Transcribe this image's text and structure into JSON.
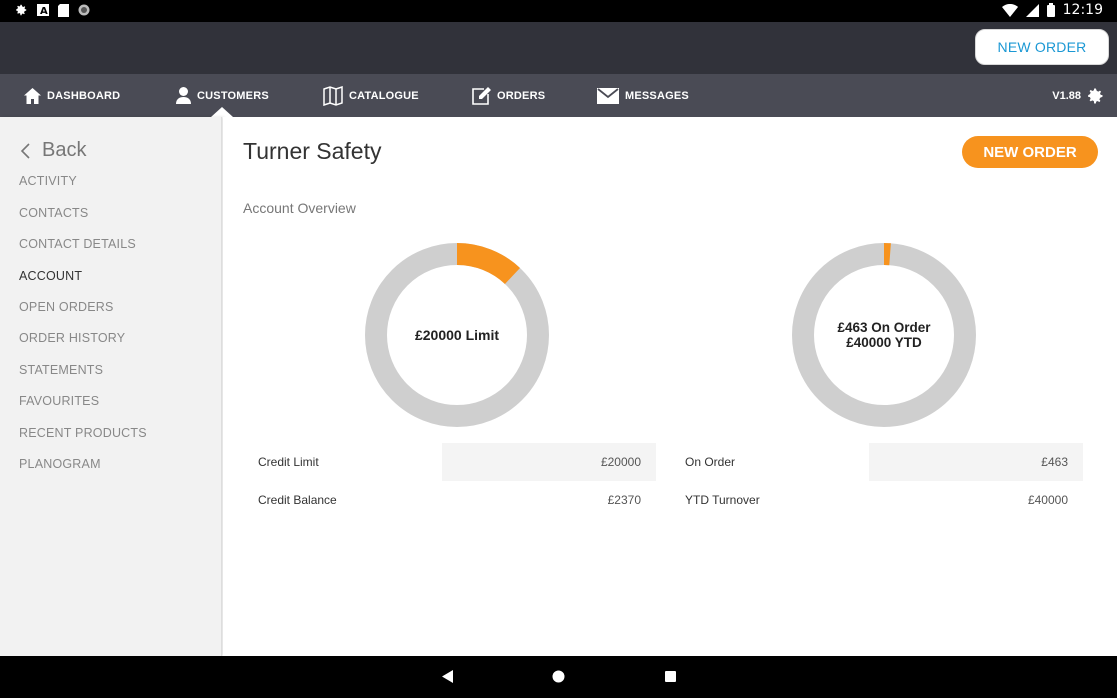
{
  "status_bar": {
    "time": "12:19",
    "left_icons": [
      "settings-icon",
      "a-icon",
      "sim-icon",
      "circle-icon"
    ],
    "right_icons": [
      "wifi-icon",
      "signal-icon",
      "battery-icon"
    ]
  },
  "topbar": {
    "new_order_label": "NEW ORDER",
    "accent": "#1b98d4"
  },
  "nav": {
    "items": [
      {
        "label": "DASHBOARD",
        "icon": "home-icon"
      },
      {
        "label": "CUSTOMERS",
        "icon": "person-icon"
      },
      {
        "label": "CATALOGUE",
        "icon": "book-icon"
      },
      {
        "label": "ORDERS",
        "icon": "edit-icon"
      },
      {
        "label": "MESSAGES",
        "icon": "mail-icon"
      }
    ],
    "active": "CUSTOMERS",
    "version": "V1.88"
  },
  "sidebar": {
    "back_label": "Back",
    "items": [
      {
        "label": "ACTIVITY"
      },
      {
        "label": "CONTACTS"
      },
      {
        "label": "CONTACT DETAILS"
      },
      {
        "label": "ACCOUNT"
      },
      {
        "label": "OPEN ORDERS"
      },
      {
        "label": "ORDER HISTORY"
      },
      {
        "label": "STATEMENTS"
      },
      {
        "label": "FAVOURITES"
      },
      {
        "label": "RECENT PRODUCTS"
      },
      {
        "label": "PLANOGRAM"
      }
    ],
    "active": "ACCOUNT"
  },
  "main": {
    "title": "Turner Safety",
    "new_order_label": "NEW ORDER",
    "button_color": "#f7931e",
    "section_title": "Account Overview",
    "credit": {
      "donut_label": "£20000 Limit",
      "fill_fraction": 0.12,
      "rows": [
        {
          "label": "Credit Limit",
          "value": "£20000"
        },
        {
          "label": "Credit Balance",
          "value": "£2370"
        }
      ]
    },
    "orders": {
      "donut_label_line1": "£463 On Order",
      "donut_label_line2": "£40000 YTD",
      "fill_fraction": 0.012,
      "rows": [
        {
          "label": "On Order",
          "value": "£463"
        },
        {
          "label": "YTD Turnover",
          "value": "£40000"
        }
      ]
    }
  }
}
